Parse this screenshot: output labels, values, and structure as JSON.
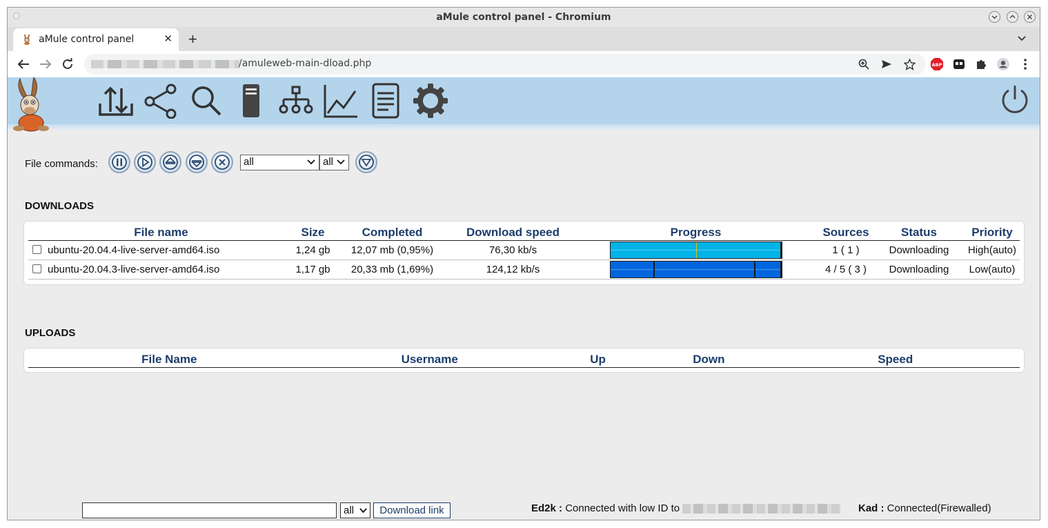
{
  "window": {
    "title": "aMule control panel - Chromium"
  },
  "tab": {
    "title": "aMule control panel"
  },
  "address_bar": {
    "url_path": "/amuleweb-main-dload.php"
  },
  "nav_icons": [
    "transfers-icon",
    "shared-files-icon",
    "search-icon",
    "servers-icon",
    "kad-network-icon",
    "statistics-icon",
    "log-icon",
    "preferences-icon"
  ],
  "file_commands": {
    "label": "File commands:",
    "filter_category": "all",
    "filter_status": "all"
  },
  "downloads": {
    "title": "DOWNLOADS",
    "columns": [
      "File name",
      "Size",
      "Completed",
      "Download speed",
      "Progress",
      "Sources",
      "Status",
      "Priority"
    ],
    "rows": [
      {
        "file_name": "ubuntu-20.04.4-live-server-amd64.iso",
        "size": "1,24 gb",
        "completed": "12,07 mb (0,95%)",
        "speed": "76,30 kb/s",
        "sources": "1 ( 1 )",
        "status": "Downloading",
        "priority": "High(auto)",
        "progress_color": "#00b3e6",
        "progress_marks": [
          0.5
        ]
      },
      {
        "file_name": "ubuntu-20.04.3-live-server-amd64.iso",
        "size": "1,17 gb",
        "completed": "20,33 mb (1,69%)",
        "speed": "124,12 kb/s",
        "sources": "4 / 5 ( 3 )",
        "status": "Downloading",
        "priority": "Low(auto)",
        "progress_color": "#0066dd",
        "progress_marks": [
          0.25,
          0.84
        ]
      }
    ]
  },
  "uploads": {
    "title": "UPLOADS",
    "columns": [
      "File Name",
      "Username",
      "Up",
      "Down",
      "Speed"
    ]
  },
  "footer": {
    "link_filter": "all",
    "download_link_label": "Download link",
    "ed2k_label": "Ed2k :",
    "ed2k_status": "Connected with low ID to",
    "kad_label": "Kad :",
    "kad_status": "Connected(Firewalled)"
  }
}
